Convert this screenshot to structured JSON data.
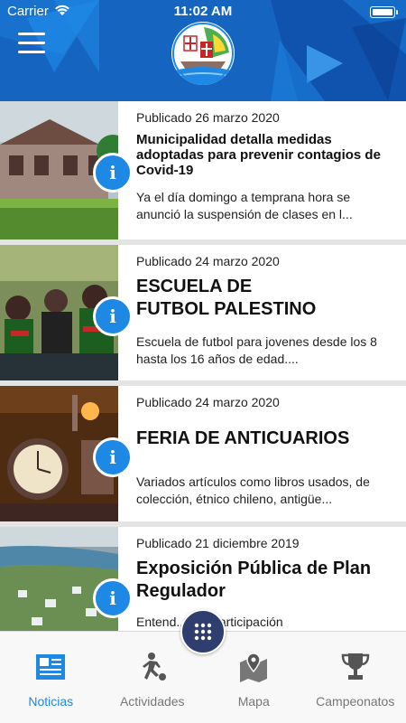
{
  "status_bar": {
    "carrier": "Carrier",
    "time": "11:02 AM"
  },
  "header": {
    "menu_icon": "hamburger-menu-icon",
    "logo_icon": "club-crest-logo"
  },
  "news": [
    {
      "date": "Publicado 26 marzo 2020",
      "title": "Municipalidad detalla medidas adoptadas para prevenir contagios de Covid-19",
      "description": "Ya el día domingo a temprana hora se anunció la suspensión de clases en l...",
      "info_icon": "i"
    },
    {
      "date": "Publicado 24 marzo 2020",
      "title": "ESCUELA DE FUTBOL PALESTINO",
      "description": "Escuela de futbol para jovenes desde los 8 hasta los 16 años de edad....",
      "info_icon": "i"
    },
    {
      "date": "Publicado 24 marzo 2020",
      "title": "FERIA DE ANTICUARIOS",
      "description": "Variados artículos como libros usados, de colección, étnico chileno, antigüe...",
      "info_icon": "i"
    },
    {
      "date": "Publicado 21 diciembre 2019",
      "title": "Exposición Pública de Plan Regulador",
      "description": "Entend... por participación",
      "info_icon": "i"
    }
  ],
  "tabs": [
    {
      "label": "Noticias",
      "icon": "newspaper-icon",
      "active": true
    },
    {
      "label": "Actividades",
      "icon": "running-person-icon",
      "active": false
    },
    {
      "label": "Mapa",
      "icon": "map-pin-icon",
      "active": false
    },
    {
      "label": "Campeonatos",
      "icon": "trophy-icon",
      "active": false
    }
  ],
  "colors": {
    "header": "#1565c0",
    "accent": "#1e88e5",
    "fab": "#2f3e6e"
  }
}
